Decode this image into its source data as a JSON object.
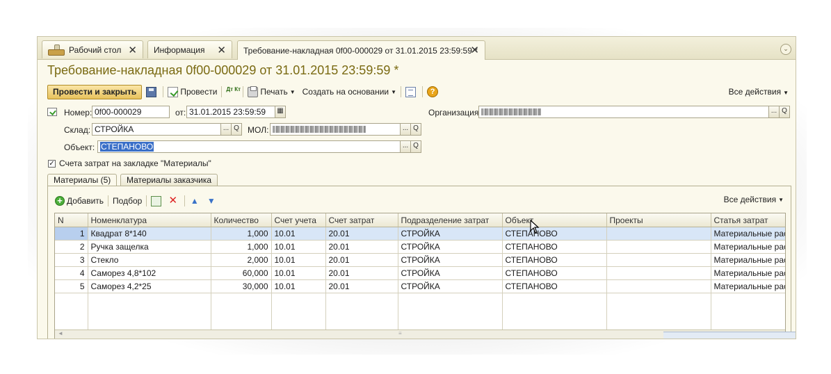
{
  "tabs": [
    {
      "label": "Рабочий стол",
      "icon": "desk-home-icon"
    },
    {
      "label": "Информация"
    },
    {
      "label": "Требование-накладная 0f00-000029 от 31.01.2015 23:59:59 *"
    }
  ],
  "document": {
    "title": "Требование-накладная 0f00-000029 от 31.01.2015 23:59:59 *"
  },
  "toolbar": {
    "post_close": "Провести и закрыть",
    "post": "Провести",
    "dt_kt": "Дт Кт",
    "print": "Печать",
    "create_based": "Создать на основании",
    "help": "?",
    "all_actions": "Все действия"
  },
  "form": {
    "number_label": "Номер:",
    "number_value": "0f00-000029",
    "date_label": "от:",
    "date_value": "31.01.2015 23:59:59",
    "org_label": "Организация:",
    "warehouse_label": "Склад:",
    "warehouse_value": "СТРОЙКА",
    "mol_label": "МОЛ:",
    "object_label": "Объект:",
    "object_value": "СТЕПАНОВО",
    "checkbox_label": "Счета затрат на закладке \"Материалы\"",
    "lookup_button": "...",
    "search_button": "Q"
  },
  "inner_tabs": [
    "Материалы (5)",
    "Материалы заказчика"
  ],
  "table_toolbar": {
    "add": "Добавить",
    "pick": "Подбор",
    "all_actions": "Все действия"
  },
  "table": {
    "columns": [
      "N",
      "Номенклатура",
      "Количество",
      "Счет учета",
      "Счет затрат",
      "Подразделение затрат",
      "Объект",
      "Проекты",
      "Статья затрат"
    ],
    "rows": [
      [
        "1",
        "Квадрат 8*140",
        "1,000",
        "10.01",
        "20.01",
        "СТРОЙКА",
        "СТЕПАНОВО",
        "",
        "Материальные расх"
      ],
      [
        "2",
        "Ручка защелка",
        "1,000",
        "10.01",
        "20.01",
        "СТРОЙКА",
        "СТЕПАНОВО",
        "",
        "Материальные расх"
      ],
      [
        "3",
        "Стекло",
        "2,000",
        "10.01",
        "20.01",
        "СТРОЙКА",
        "СТЕПАНОВО",
        "",
        "Материальные расх"
      ],
      [
        "4",
        "Саморез 4,8*102",
        "60,000",
        "10.01",
        "20.01",
        "СТРОЙКА",
        "СТЕПАНОВО",
        "",
        "Материальные расх"
      ],
      [
        "5",
        "Саморез 4,2*25",
        "30,000",
        "10.01",
        "20.01",
        "СТРОЙКА",
        "СТЕПАНОВО",
        "",
        "Материальные расх"
      ]
    ],
    "selected_row": 1
  }
}
